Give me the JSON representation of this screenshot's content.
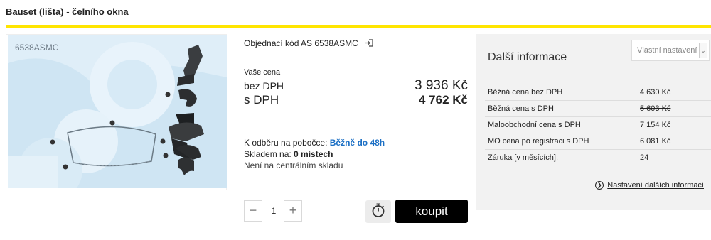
{
  "page": {
    "title": "Bauset (lišta) - čelního okna"
  },
  "product": {
    "image_code": "6538ASMC",
    "order_code_text": "Objednací kód AS 6538ASMC"
  },
  "price": {
    "caption": "Vaše cena",
    "net_label": "bez DPH",
    "net_value": "3 936 Kč",
    "gross_label": "s DPH",
    "gross_value": "4 762 Kč"
  },
  "availability": {
    "branch_label": "K odběru na pobočce:",
    "branch_value": "Běžně do 48h",
    "stock_label": "Skladem na:",
    "stock_value": "0 místech",
    "central_note": "Není na centrálním skladu"
  },
  "cart": {
    "minus": "−",
    "quantity": "1",
    "plus": "+",
    "buy_label": "koupit"
  },
  "info": {
    "title": "Další informace",
    "select_value": "Vlastní nastavení",
    "rows": [
      {
        "label": "Běžná cena bez DPH",
        "value": "4 630 Kč"
      },
      {
        "label": "Běžná cena s DPH",
        "value": "5 603 Kč"
      },
      {
        "label": "Maloobchodní cena s DPH",
        "value": "7 154 Kč"
      },
      {
        "label": "MO cena po registraci s DPH",
        "value": "6 081 Kč"
      },
      {
        "label": "Záruka [v měsících]:",
        "value": "24"
      }
    ],
    "more_link": "Nastavení dalších informací"
  },
  "colors": {
    "accent_yellow": "#ffe500",
    "link_blue": "#1b6fc4",
    "buy_bg": "#000000"
  },
  "icons": [
    "copy-icon",
    "stopwatch-icon",
    "chevron-down-icon",
    "circle-arrow-icon"
  ]
}
